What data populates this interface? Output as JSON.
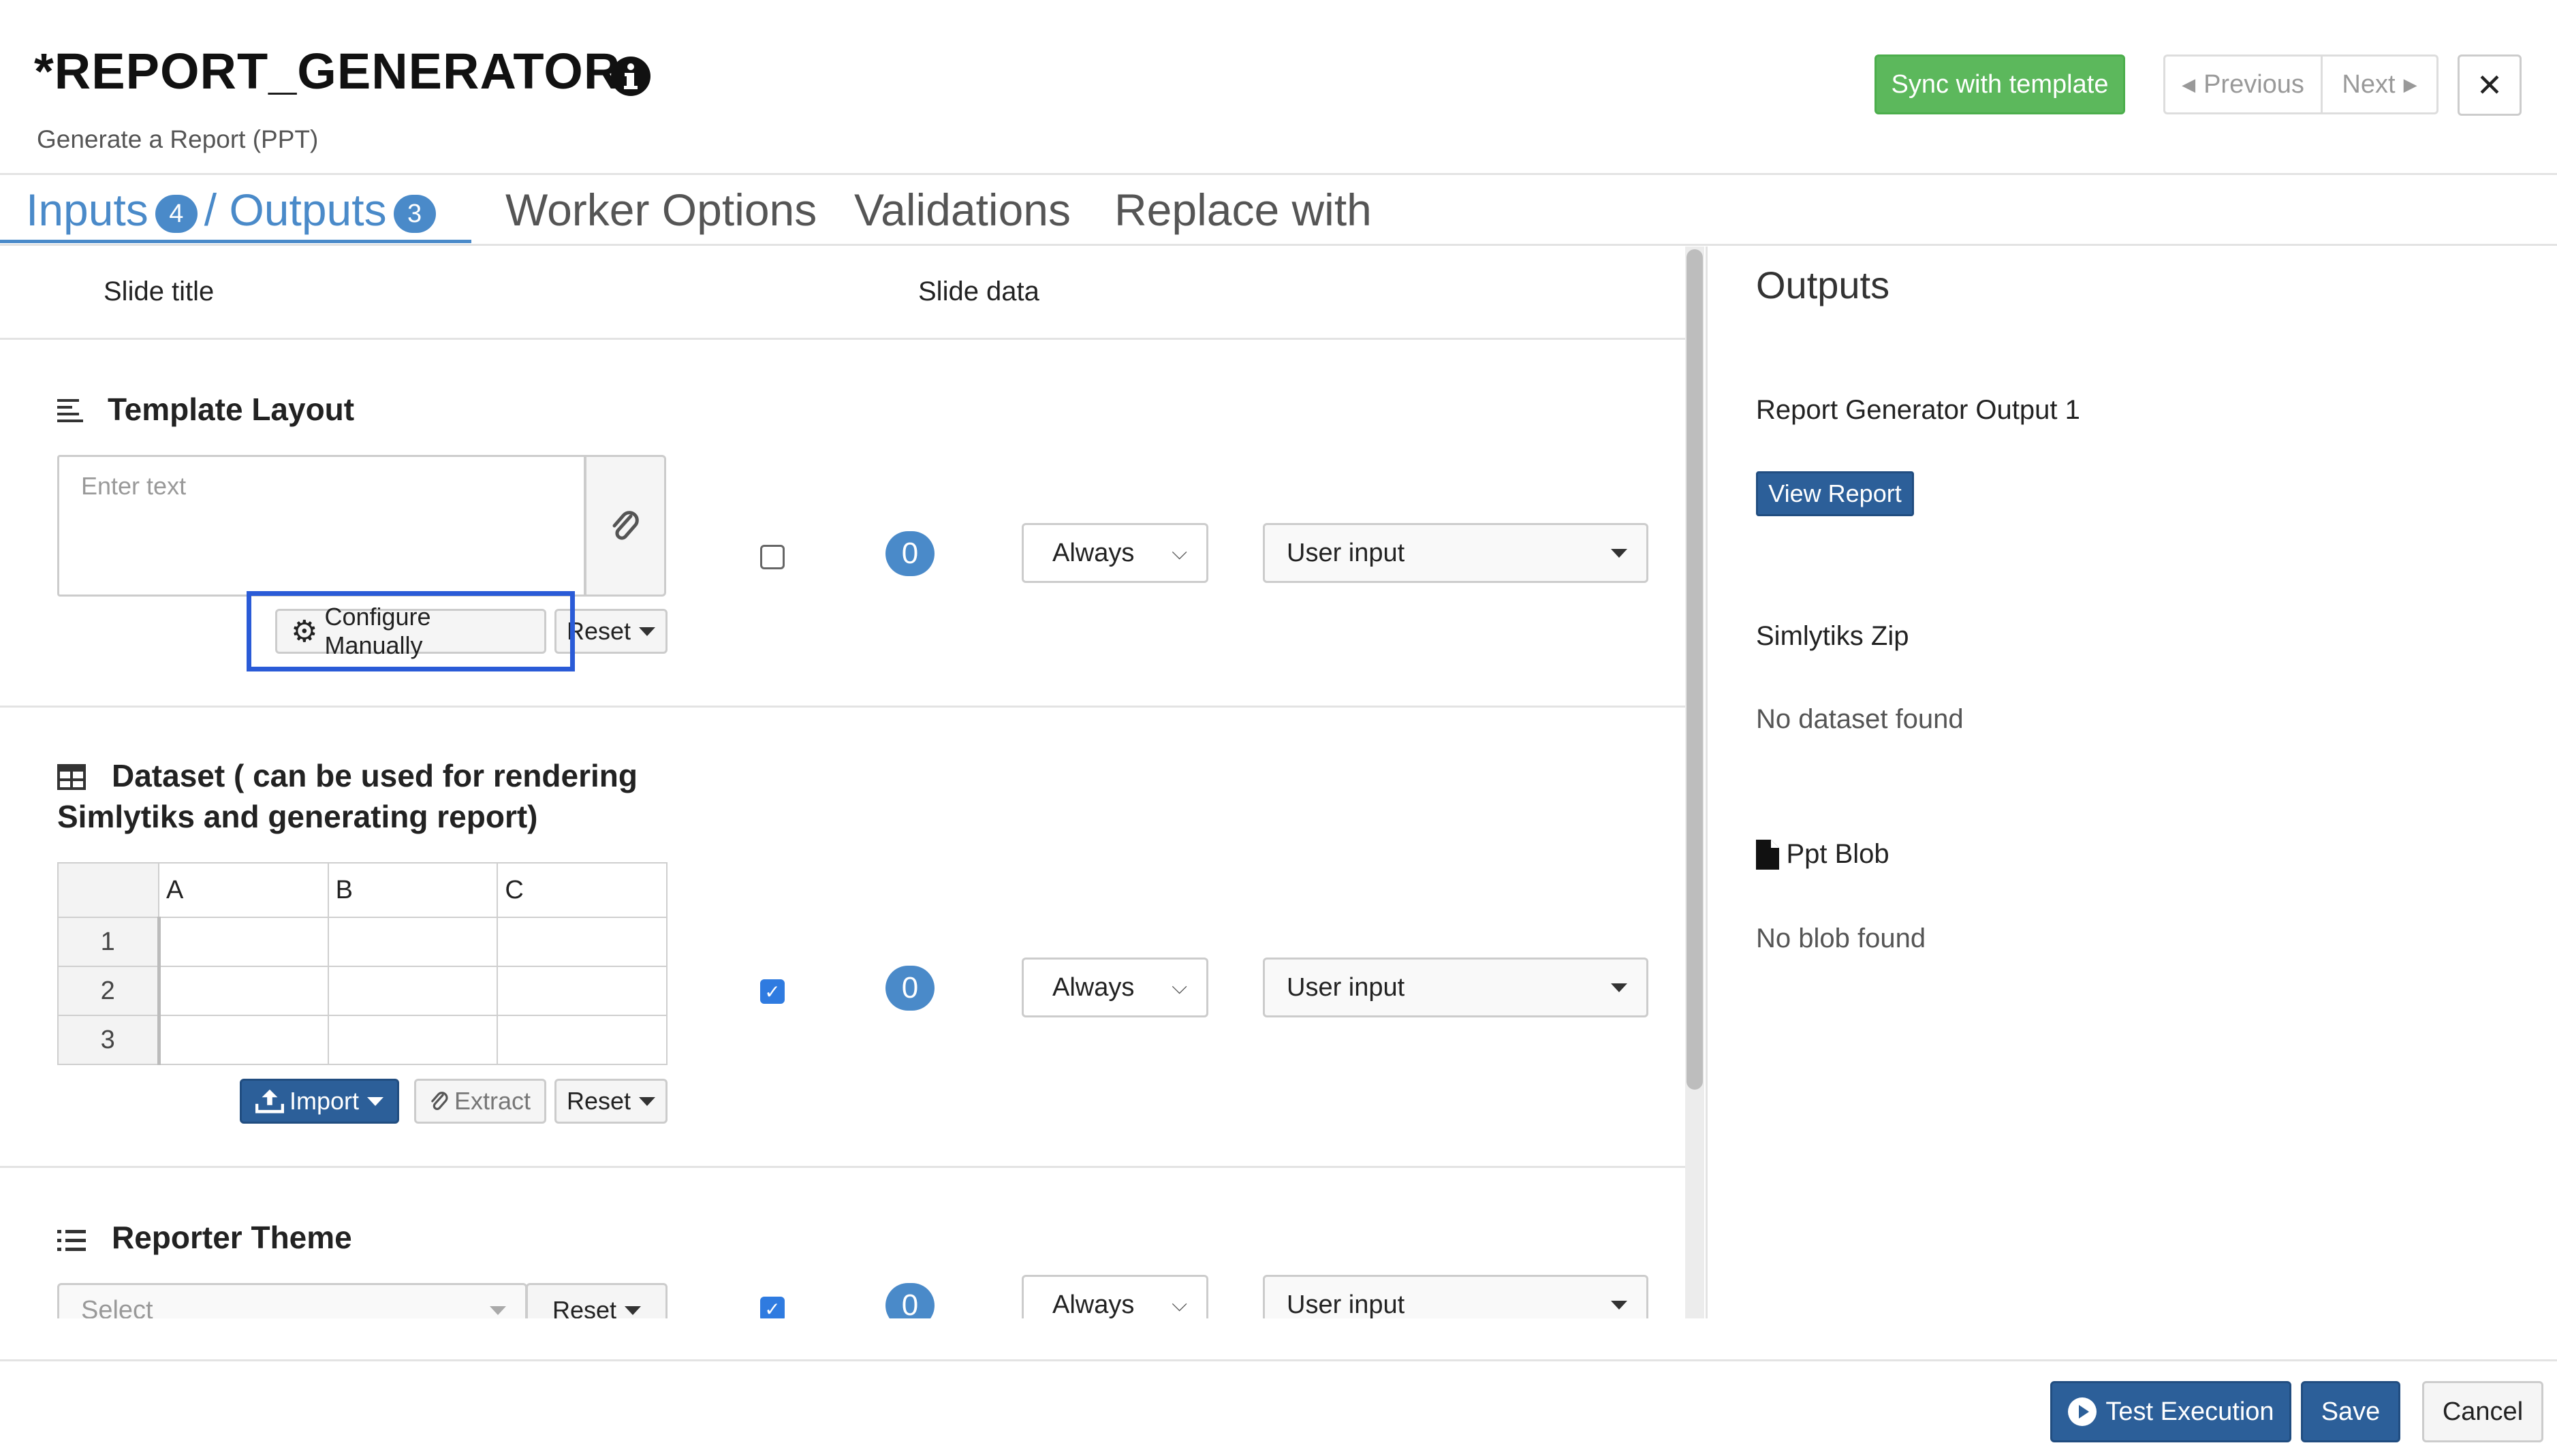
{
  "header": {
    "title": "*REPORT_GENERATOR",
    "subtitle": "Generate a Report (PPT)",
    "sync_label": "Sync with template",
    "previous_label": "Previous",
    "next_label": "Next",
    "close_label": "✕"
  },
  "tabs": {
    "inputs_label": "Inputs",
    "inputs_count": "4",
    "outputs_label": "/ Outputs",
    "outputs_count": "3",
    "worker_options": "Worker Options",
    "validations": "Validations",
    "replace_with": "Replace with"
  },
  "columns": {
    "slide_title": "Slide title",
    "slide_data": "Slide data"
  },
  "inputs": [
    {
      "title": "Template Layout",
      "placeholder": "Enter text",
      "configure_label": "Configure Manually",
      "reset_label": "Reset",
      "checked": false,
      "count": "0",
      "frequency": "Always",
      "source": "User input"
    },
    {
      "title_line1": "Dataset ( can be used for rendering",
      "title_line2": "Simlytiks and generating report)",
      "grid_columns": [
        "A",
        "B",
        "C"
      ],
      "grid_rows": [
        "1",
        "2",
        "3"
      ],
      "import_label": "Import",
      "extract_label": "Extract",
      "reset_label": "Reset",
      "checked": true,
      "count": "0",
      "frequency": "Always",
      "source": "User input"
    },
    {
      "title": "Reporter Theme",
      "select_placeholder": "Select",
      "reset_label": "Reset",
      "checked": true,
      "count": "0",
      "frequency": "Always",
      "source": "User input"
    }
  ],
  "outputs": {
    "heading": "Outputs",
    "items": [
      {
        "label": "Report Generator Output 1",
        "button": "View Report"
      },
      {
        "label": "Simlytiks Zip",
        "status": "No dataset found"
      },
      {
        "label": "Ppt Blob",
        "status": "No blob found",
        "icon": "file-icon"
      }
    ]
  },
  "footer": {
    "test_label": "Test Execution",
    "save_label": "Save",
    "cancel_label": "Cancel"
  },
  "colors": {
    "accent": "#4a8ac9",
    "primary_button": "#2c5f99",
    "success": "#5cb85c",
    "highlight_box": "#2a5bd7"
  }
}
